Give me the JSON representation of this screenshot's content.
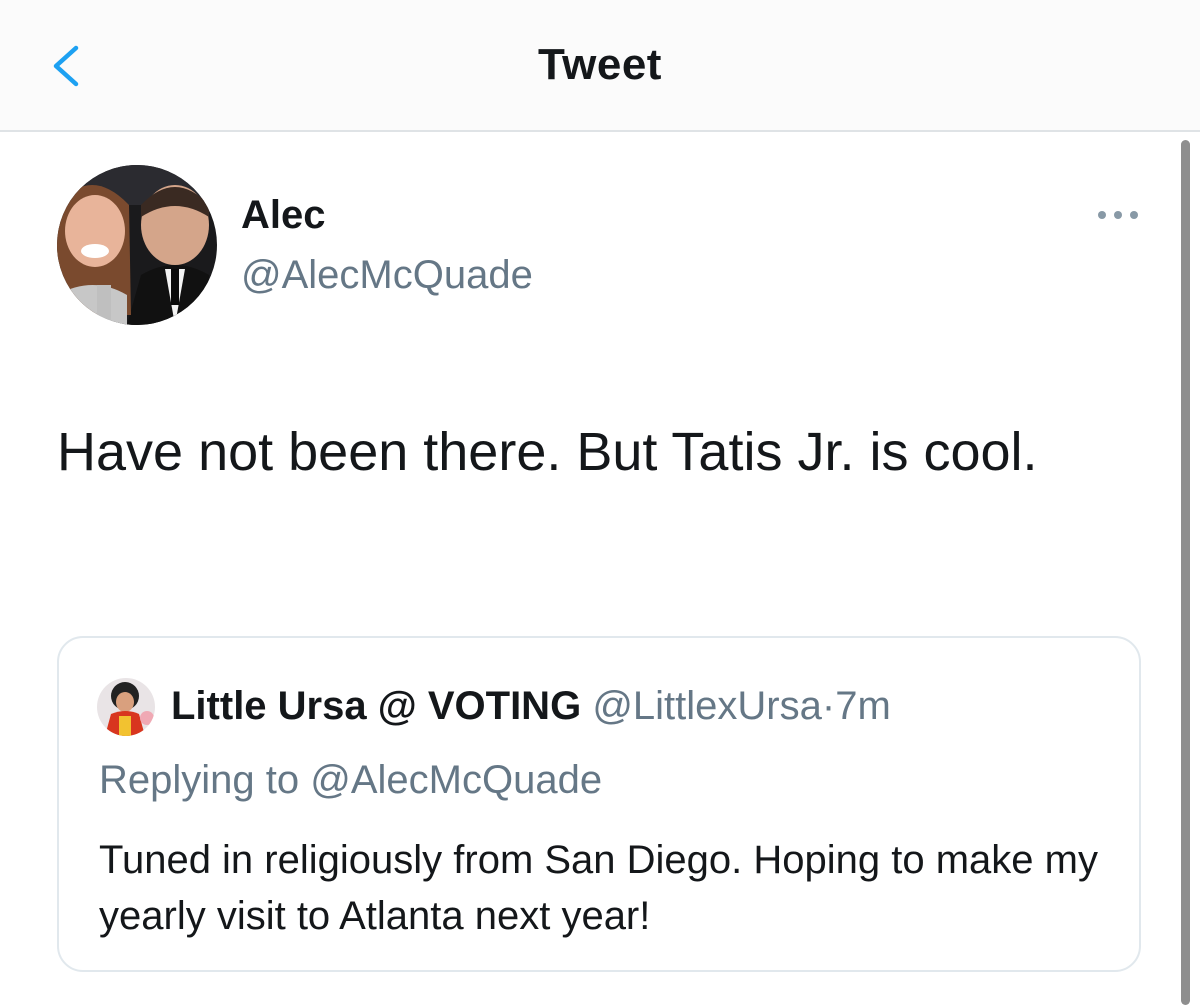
{
  "header": {
    "title": "Tweet",
    "back_icon": "chevron-left-icon"
  },
  "colors": {
    "accent": "#1da1f2",
    "secondary_text": "#657786",
    "primary_text": "#14171a",
    "divider": "#dfe3e6"
  },
  "tweet": {
    "author_name": "Alec",
    "author_handle": "@AlecMcQuade",
    "text": "Have not been there. But Tatis Jr. is cool.",
    "more_icon": "more-horizontal-icon"
  },
  "quoted_tweet": {
    "author_name": "Little Ursa @ VOTING",
    "author_handle": "@LittlexUrsa",
    "separator": "·",
    "time": "7m",
    "replying_to": "Replying to @AlecMcQuade",
    "text": "Tuned in religiously from San Diego. Hoping to make my yearly visit to Atlanta next year!"
  }
}
